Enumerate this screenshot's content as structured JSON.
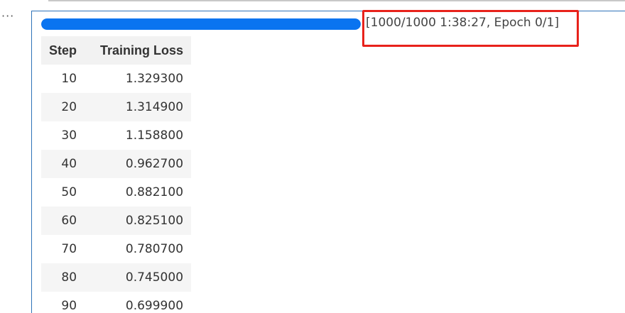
{
  "progress": {
    "fraction": 1.0,
    "status_text": "[1000/1000 1:38:27, Epoch 0/1]",
    "fill_color": "#0a74f0"
  },
  "highlight": {
    "color": "#e8221b"
  },
  "toolbar": {
    "more_icon": "more-horizontal-icon",
    "more_glyph": "···"
  },
  "table": {
    "columns": [
      "Step",
      "Training Loss"
    ],
    "rows": [
      [
        "10",
        "1.329300"
      ],
      [
        "20",
        "1.314900"
      ],
      [
        "30",
        "1.158800"
      ],
      [
        "40",
        "0.962700"
      ],
      [
        "50",
        "0.882100"
      ],
      [
        "60",
        "0.825100"
      ],
      [
        "70",
        "0.780700"
      ],
      [
        "80",
        "0.745000"
      ],
      [
        "90",
        "0.699900"
      ]
    ]
  }
}
